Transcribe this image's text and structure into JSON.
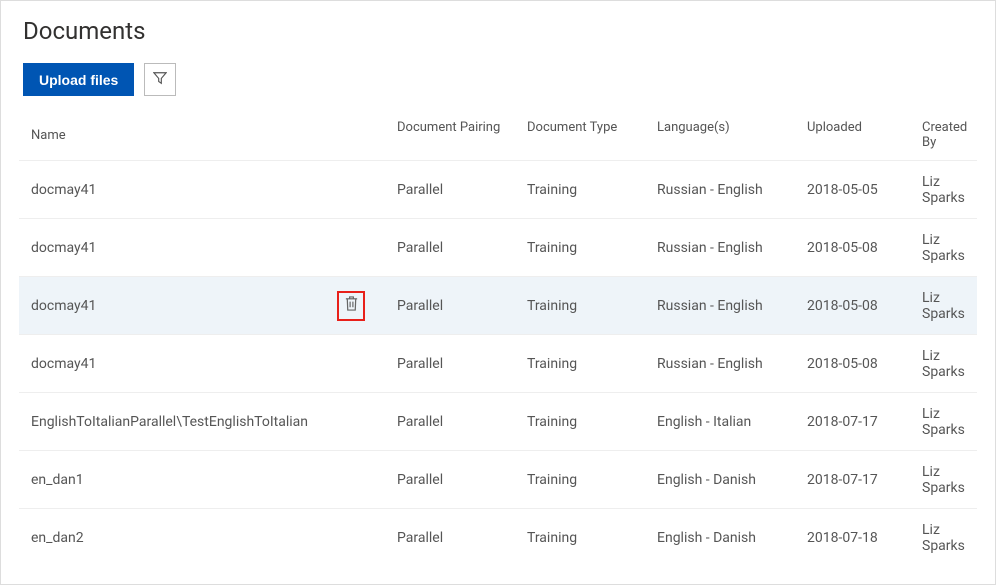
{
  "page_title": "Documents",
  "toolbar": {
    "upload_label": "Upload files"
  },
  "table": {
    "headers": {
      "name": "Name",
      "pairing": "Document Pairing",
      "type": "Document Type",
      "languages": "Language(s)",
      "uploaded": "Uploaded",
      "created_by": "Created By"
    },
    "rows": [
      {
        "name": "docmay41",
        "pairing": "Parallel",
        "type": "Training",
        "languages": "Russian - English",
        "uploaded": "2018-05-05",
        "created_by": "Liz Sparks",
        "highlighted": false,
        "show_trash": false
      },
      {
        "name": "docmay41",
        "pairing": "Parallel",
        "type": "Training",
        "languages": "Russian - English",
        "uploaded": "2018-05-08",
        "created_by": "Liz Sparks",
        "highlighted": false,
        "show_trash": false
      },
      {
        "name": "docmay41",
        "pairing": "Parallel",
        "type": "Training",
        "languages": "Russian - English",
        "uploaded": "2018-05-08",
        "created_by": "Liz Sparks",
        "highlighted": true,
        "show_trash": true
      },
      {
        "name": "docmay41",
        "pairing": "Parallel",
        "type": "Training",
        "languages": "Russian - English",
        "uploaded": "2018-05-08",
        "created_by": "Liz Sparks",
        "highlighted": false,
        "show_trash": false
      },
      {
        "name": "EnglishToItalianParallel\\TestEnglishToItalian",
        "pairing": "Parallel",
        "type": "Training",
        "languages": "English - Italian",
        "uploaded": "2018-07-17",
        "created_by": "Liz Sparks",
        "highlighted": false,
        "show_trash": false
      },
      {
        "name": "en_dan1",
        "pairing": "Parallel",
        "type": "Training",
        "languages": "English - Danish",
        "uploaded": "2018-07-17",
        "created_by": "Liz Sparks",
        "highlighted": false,
        "show_trash": false
      },
      {
        "name": "en_dan2",
        "pairing": "Parallel",
        "type": "Training",
        "languages": "English - Danish",
        "uploaded": "2018-07-18",
        "created_by": "Liz Sparks",
        "highlighted": false,
        "show_trash": false
      }
    ]
  }
}
